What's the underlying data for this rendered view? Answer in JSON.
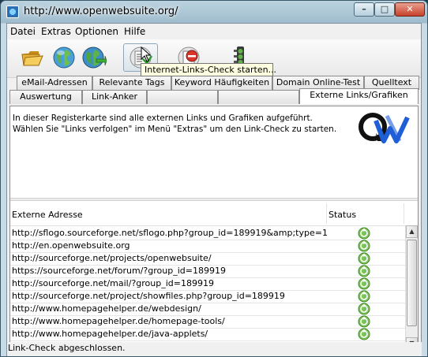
{
  "window": {
    "title": "http://www.openwebsuite.org/"
  },
  "menu": [
    "Datei",
    "Extras",
    "Optionen",
    "Hilfe"
  ],
  "toolbar": {
    "buttons": [
      {
        "name": "open-folder-icon"
      },
      {
        "name": "globe-icon"
      },
      {
        "name": "globe-arrow-icon"
      },
      {
        "name": "link-check-icon",
        "active": true
      },
      {
        "name": "stop-icon"
      },
      {
        "name": "traffic-light-icon"
      }
    ],
    "tooltip": "Internet-Links-Check starten..."
  },
  "tabs_row1": [
    "eMail-Adressen",
    "Relevante Tags",
    "Keyword Häufigkeiten",
    "Domain Online-Test",
    "Quelltext"
  ],
  "tabs_row2": [
    "Auswertung",
    "Link-Anker",
    "",
    "",
    "Externe Links/Grafiken"
  ],
  "panel": {
    "info_line1": "In dieser Registerkarte sind alle externen Links und Grafiken aufgeführt.",
    "info_line2": "Wählen Sie \"Links verfolgen\" im Menü \"Extras\" um den Link-Check zu starten."
  },
  "table": {
    "col_address": "Externe Adresse",
    "col_status": "Status",
    "rows": [
      "http://sflogo.sourceforge.net/sflogo.php?group_id=189919&amp;type=1",
      "http://en.openwebsuite.org",
      "http://sourceforge.net/projects/openwebsuite/",
      "https://sourceforge.net/forum/?group_id=189919",
      "http://sourceforge.net/mail/?group_id=189919",
      "http://sourceforge.net/project/showfiles.php?group_id=189919",
      "http://www.homepagehelper.de/webdesign/",
      "http://www.homepagehelper.de/homepage-tools/",
      "http://www.homepagehelper.de/java-applets/"
    ]
  },
  "status": "Link-Check abgeschlossen."
}
